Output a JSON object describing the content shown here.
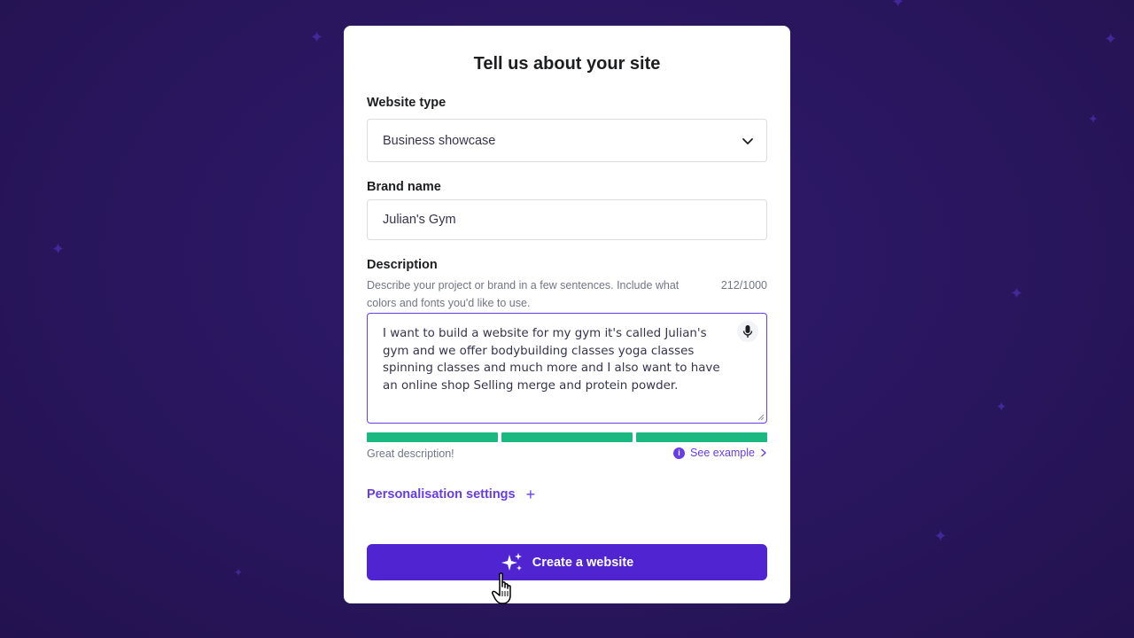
{
  "dialog": {
    "title": "Tell us about your site"
  },
  "website_type": {
    "label": "Website type",
    "selected": "Business showcase"
  },
  "brand_name": {
    "label": "Brand name",
    "value": "Julian's Gym"
  },
  "description": {
    "label": "Description",
    "helper": "Describe your project or brand in a few sentences. Include what colors and fonts you'd like to use.",
    "counter": "212/1000",
    "value": "I want to build a website for my gym it's called Julian's gym and we offer bodybuilding classes yoga classes spinning classes and much more and I also want to have an online shop Selling merge and protein powder.",
    "quality_text": "Great description!",
    "quality_level": 1.0,
    "see_example": "See example"
  },
  "personalisation": {
    "label": "Personalisation settings"
  },
  "create_button": {
    "label": "Create a website"
  },
  "icons": [
    "chevron-down-icon",
    "microphone-icon",
    "info-icon",
    "chevron-right-icon",
    "plus-icon",
    "sparkles-icon",
    "hand-cursor-icon"
  ],
  "colors": {
    "background": "#2a1660",
    "accent": "#673de6",
    "button": "#5025d1",
    "success": "#1bb981"
  }
}
